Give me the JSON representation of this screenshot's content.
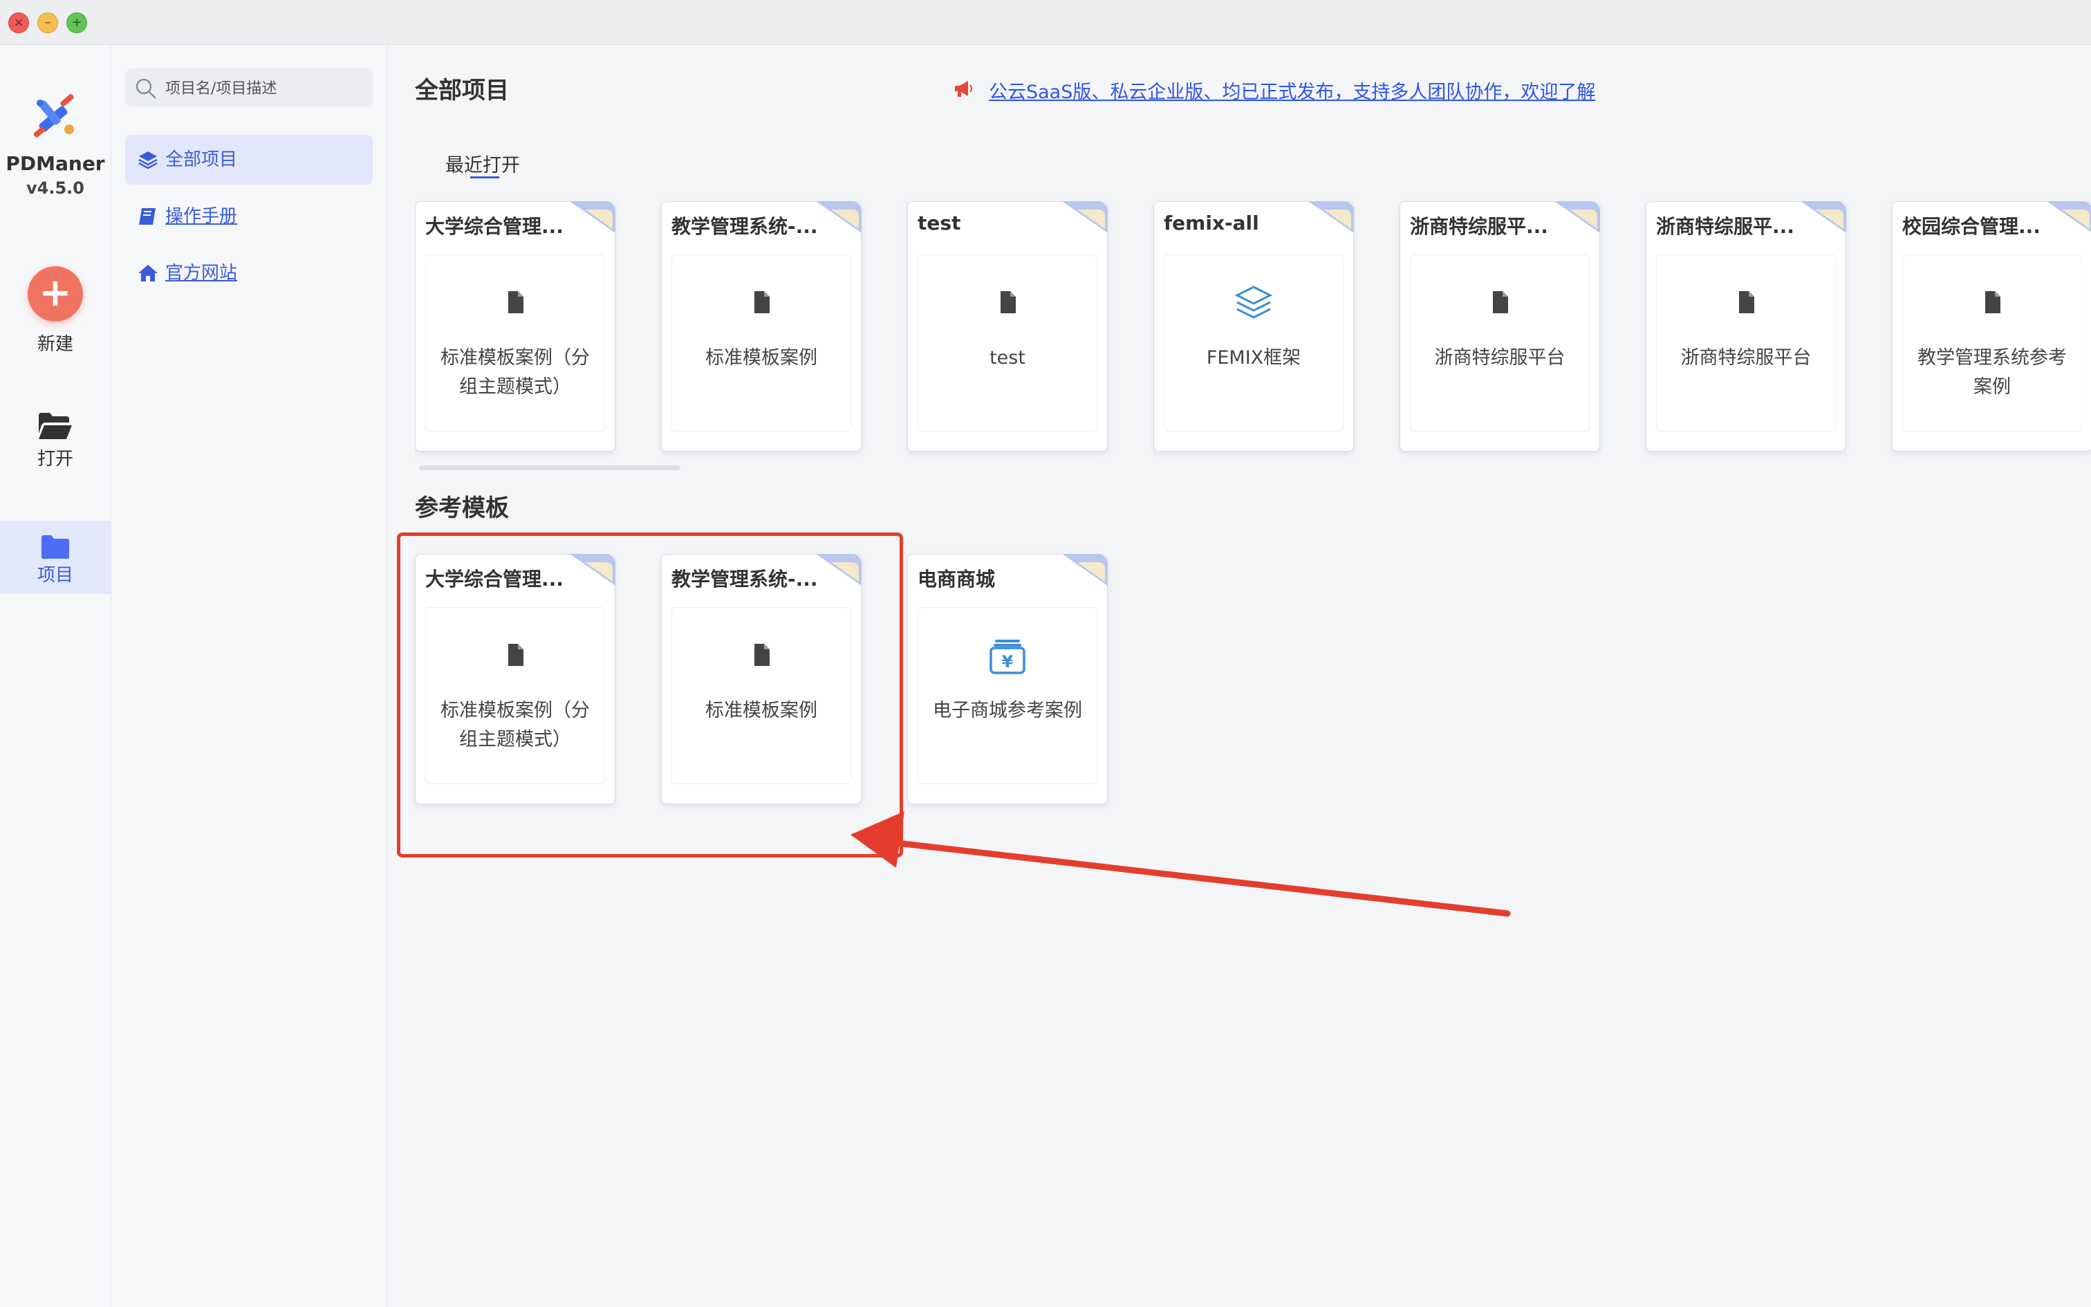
{
  "window": {
    "controls": {
      "close_icon": "close-icon",
      "minimize_icon": "minimize-icon",
      "zoom_icon": "zoom-icon"
    }
  },
  "app": {
    "name": "PDManer",
    "version": "v4.5.0"
  },
  "leftnav": {
    "new_label": "新建",
    "open_label": "打开",
    "project_label": "项目"
  },
  "sidebar": {
    "search": {
      "placeholder": "项目名/项目描述",
      "value": ""
    },
    "items": [
      {
        "label": "全部项目",
        "icon": "layers-icon",
        "active": true
      },
      {
        "label": "操作手册",
        "icon": "book-icon",
        "active": false
      },
      {
        "label": "官方网站",
        "icon": "home-icon",
        "active": false
      }
    ]
  },
  "main": {
    "title": "全部项目",
    "announcement": "公云SaaS版、私云企业版、均已正式发布，支持多人团队协作，欢迎了解",
    "recent_title": "最近打开",
    "templates_title": "参考模板",
    "recent": [
      {
        "title": "大学综合管理...",
        "desc": "标准模板案例（分组主题模式）",
        "icon": "file-icon"
      },
      {
        "title": "教学管理系统-...",
        "desc": "标准模板案例",
        "icon": "file-icon"
      },
      {
        "title": "test",
        "desc": "test",
        "icon": "file-icon"
      },
      {
        "title": "femix-all",
        "desc": "FEMIX框架",
        "icon": "layers-icon"
      },
      {
        "title": "浙商特综服平...",
        "desc": "浙商特综服平台",
        "icon": "file-icon"
      },
      {
        "title": "浙商特综服平...",
        "desc": "浙商特综服平台",
        "icon": "file-icon"
      },
      {
        "title": "校园综合管理...",
        "desc": "教学管理系统参考案例",
        "icon": "file-icon"
      }
    ],
    "templates": [
      {
        "title": "大学综合管理...",
        "desc": "标准模板案例（分组主题模式）",
        "icon": "file-icon"
      },
      {
        "title": "教学管理系统-...",
        "desc": "标准模板案例",
        "icon": "file-icon"
      },
      {
        "title": "电商商城",
        "desc": "电子商城参考案例",
        "icon": "cash-register-icon"
      }
    ]
  },
  "colors": {
    "accent": "#3b5bdb",
    "new_button": "#f07461",
    "highlight": "#e53d2d",
    "nav_active_bg": "#e3e7fb"
  }
}
